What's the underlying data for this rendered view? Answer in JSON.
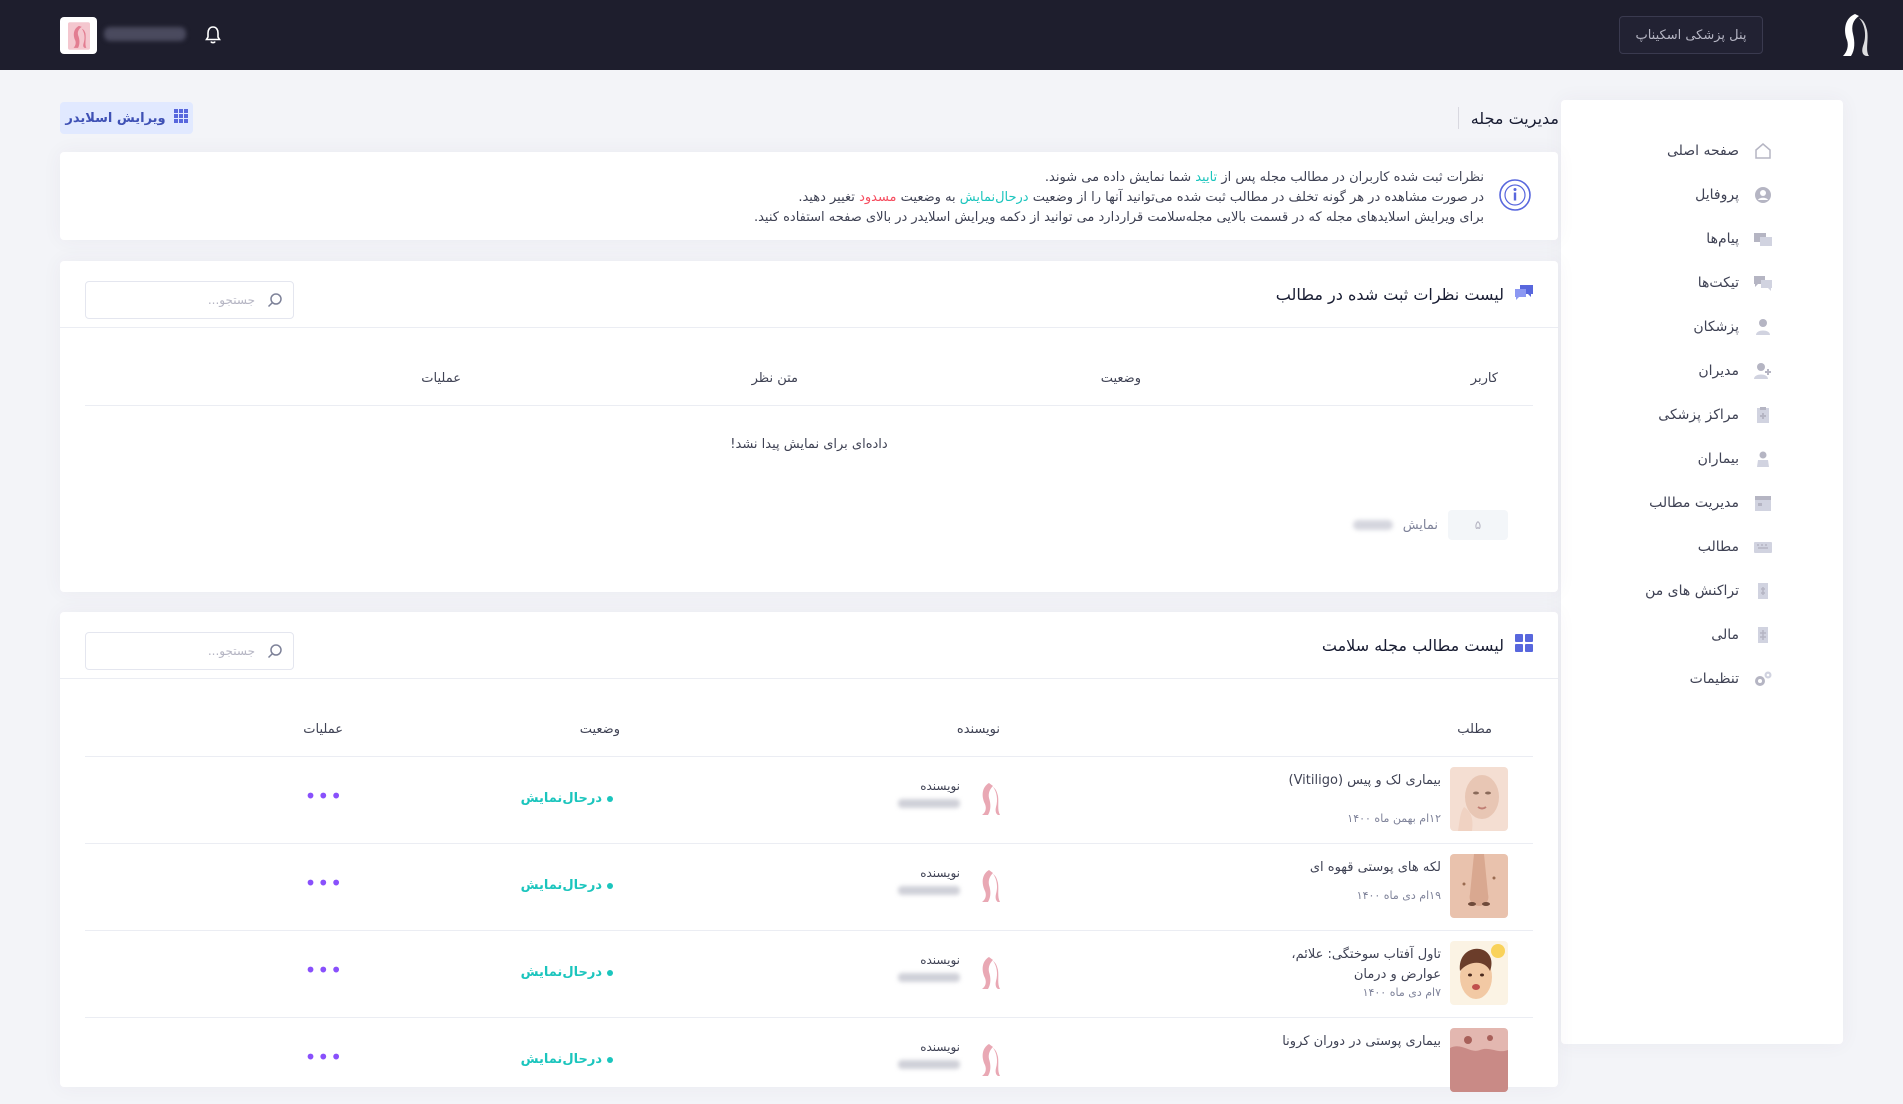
{
  "topbar": {
    "panel_label": "پنل پزشکی اسکیناپ"
  },
  "sidebar": {
    "items": [
      {
        "label": "صفحه اصلی",
        "icon": "home-icon"
      },
      {
        "label": "پروفایل",
        "icon": "user-circle-icon"
      },
      {
        "label": "پیام‌ها",
        "icon": "messages-icon"
      },
      {
        "label": "تیکت‌ها",
        "icon": "tickets-icon"
      },
      {
        "label": "پزشکان",
        "icon": "doctor-icon"
      },
      {
        "label": "مدیران",
        "icon": "admins-icon"
      },
      {
        "label": "مراکز پزشکی",
        "icon": "clipboard-icon"
      },
      {
        "label": "بیماران",
        "icon": "patient-icon"
      },
      {
        "label": "مدیریت مطالب",
        "icon": "calendar-icon"
      },
      {
        "label": "مطالب",
        "icon": "keyboard-icon"
      },
      {
        "label": "تراکنش های من",
        "icon": "receipt-icon"
      },
      {
        "label": "مالی",
        "icon": "wallet-icon"
      },
      {
        "label": "تنظیمات",
        "icon": "settings-icon"
      }
    ]
  },
  "page": {
    "title": "مدیریت مجله",
    "slider_button": "ویرایش اسلایدر"
  },
  "info": {
    "line1_a": "نظرات ثبت شده کاربران در مطالب مجله پس از",
    "line1_hl": "تایید",
    "line1_b": "شما نمایش داده می شوند.",
    "line2_a": "در صورت مشاهده در هر گونه تخلف در مطالب ثبت شده می‌توانید آنها را از وضعیت",
    "line2_hl1": "درحال‌نمایش",
    "line2_b": "به وضعیت",
    "line2_hl2": "مسدود",
    "line2_c": "تغییر دهید.",
    "line3": "برای ویرایش اسلایدهای مجله که در قسمت بالایی مجله‌سلامت قراردارد می توانید از دکمه ویرایش اسلایدر در بالای صفحه استفاده کنید."
  },
  "comments": {
    "title": "لیست نظرات ثبت شده در مطالب",
    "search_placeholder": "جستجو...",
    "columns": [
      "کاربر",
      "وضعیت",
      "متن نظر",
      "عملیات"
    ],
    "empty": "داده‌ای برای نمایش پیدا نشد!",
    "pager_label": "نمایش",
    "pager_value": "۵"
  },
  "articles": {
    "title": "لیست مطالب مجله سلامت",
    "search_placeholder": "جستجو...",
    "columns": [
      "مطلب",
      "نویسنده",
      "وضعیت",
      "عملیات"
    ],
    "author_label": "نویسنده",
    "ops": "•••",
    "rows": [
      {
        "title": "بیماری لک و پیس (Vitiligo)",
        "date": "۱۲ام بهمن ماه ۱۴۰۰",
        "status": "درحال‌نمایش",
        "thumb_color": "#e8c6b4"
      },
      {
        "title": "لکه های پوستی قهوه ای",
        "date": "۱۹ام دی ماه ۱۴۰۰",
        "status": "درحال‌نمایش",
        "thumb_color": "#d9a890"
      },
      {
        "title": "تاول آفتاب سوختگی: علائم، عوارض و درمان",
        "date": "۷ام دی ماه ۱۴۰۰",
        "status": "درحال‌نمایش",
        "thumb_color": "#f2d4a8"
      },
      {
        "title": "بیماری پوستی در دوران کرونا",
        "date": "",
        "status": "درحال‌نمایش",
        "thumb_color": "#c98a86"
      }
    ]
  }
}
